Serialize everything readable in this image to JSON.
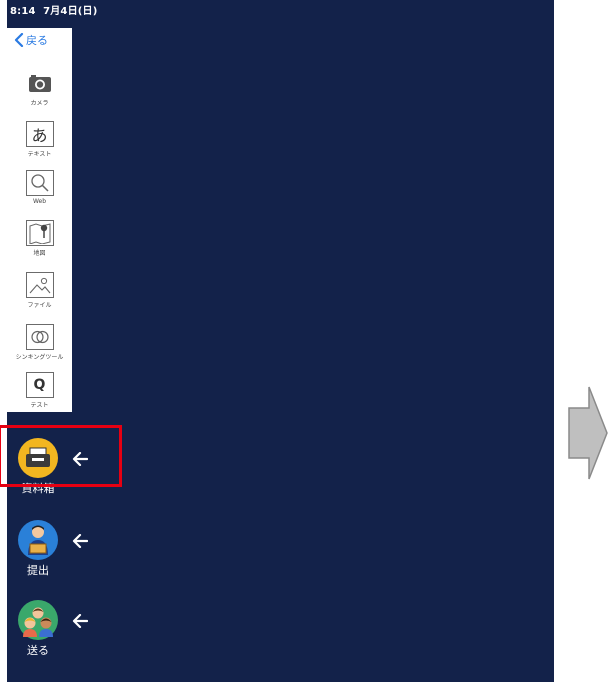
{
  "status_bar": {
    "time": "8:14",
    "date": "7月4日(日)"
  },
  "toolbar": {
    "back_label": "戻る",
    "tools": [
      {
        "label": "カメラ",
        "icon": "camera-icon"
      },
      {
        "label": "テキスト",
        "icon": "text-a-icon",
        "glyph": "あ"
      },
      {
        "label": "Web",
        "icon": "magnifier-icon"
      },
      {
        "label": "地図",
        "icon": "map-pin-icon"
      },
      {
        "label": "ファイル",
        "icon": "image-file-icon"
      },
      {
        "label": "シンキングツール",
        "icon": "venn-icon"
      },
      {
        "label": "テスト",
        "icon": "quiz-q-icon",
        "glyph": "Q"
      }
    ]
  },
  "sidebar": {
    "items": [
      {
        "label": "資料箱",
        "icon": "printer-tray-icon",
        "color": "#f2b620"
      },
      {
        "label": "提出",
        "icon": "student-submit-icon",
        "color": "#2a80d8"
      },
      {
        "label": "送る",
        "icon": "children-group-icon",
        "color": "#3aa86b"
      }
    ]
  },
  "colors": {
    "screen_bg": "#13224a",
    "highlight": "#e60012",
    "accent": "#2a7ae2"
  }
}
